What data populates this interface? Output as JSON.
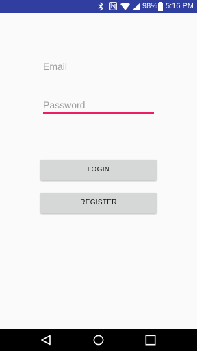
{
  "status_bar": {
    "battery_text": "98%",
    "time": "5:16 PM",
    "icons": [
      "bluetooth-icon",
      "nfc-icon",
      "wifi-icon",
      "signal-icon",
      "battery-icon"
    ],
    "background": "#303f9f"
  },
  "form": {
    "email_placeholder": "Email",
    "password_placeholder": "Password",
    "focus_color": "#e91e63"
  },
  "buttons": {
    "login_label": "LOGIN",
    "register_label": "REGISTER"
  },
  "nav_bar": {
    "icons": [
      "back-icon",
      "home-icon",
      "recent-apps-icon"
    ]
  }
}
